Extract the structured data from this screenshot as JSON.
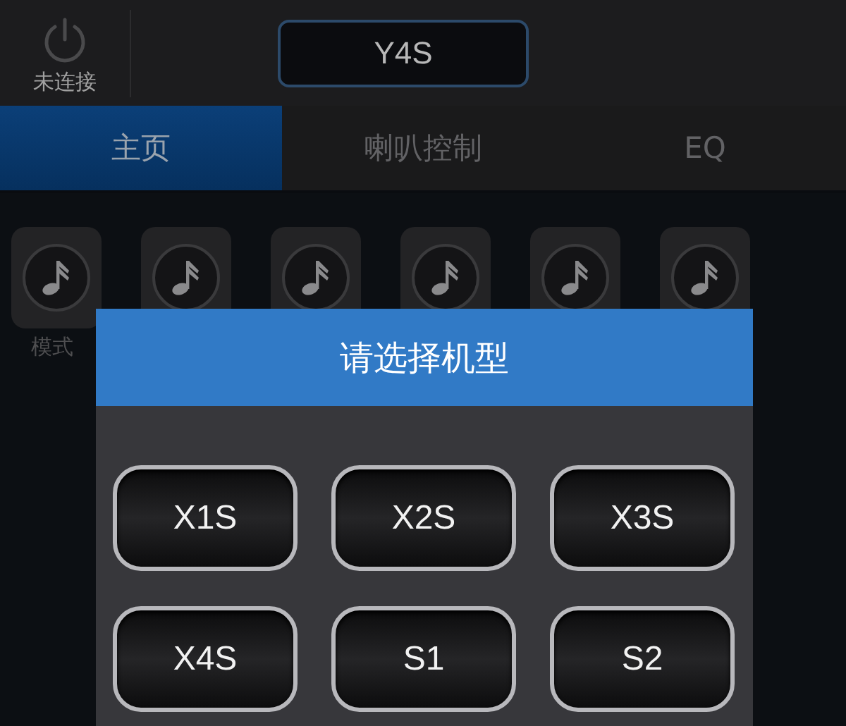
{
  "header": {
    "status": "未连接",
    "device": "Y4S"
  },
  "tabs": [
    {
      "label": "主页",
      "selected": true
    },
    {
      "label": "喇叭控制",
      "selected": false
    },
    {
      "label": "EQ",
      "selected": false
    }
  ],
  "modes": [
    {
      "kind": "music",
      "label": "模式"
    },
    {
      "kind": "music"
    },
    {
      "kind": "music"
    },
    {
      "kind": "music"
    },
    {
      "kind": "music"
    },
    {
      "kind": "music"
    }
  ],
  "dialog": {
    "title": "请选择机型",
    "options": [
      "X1S",
      "X2S",
      "X3S",
      "X4S",
      "S1",
      "S2"
    ]
  }
}
